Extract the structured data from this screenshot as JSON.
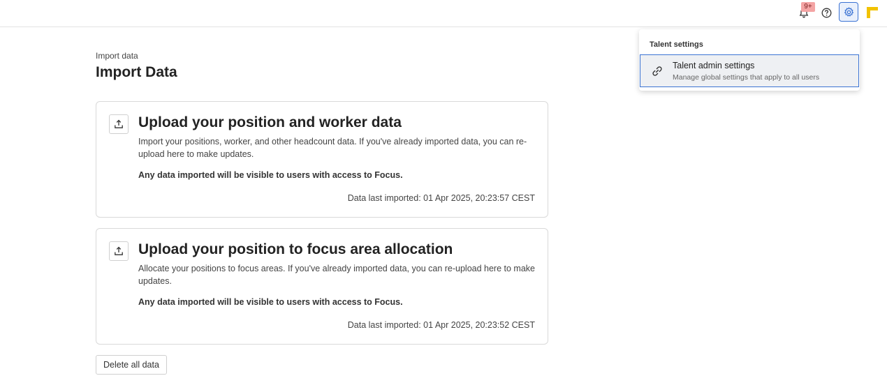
{
  "topbar": {
    "notifications_badge": "9+",
    "icons": [
      "bell-icon",
      "help-icon",
      "gear-icon",
      "app-logo"
    ],
    "accent_color": "#3b73d3",
    "logo_color": "#f2c200"
  },
  "breadcrumb": "Import data",
  "page_title": "Import Data",
  "cards": [
    {
      "title": "Upload your position and worker data",
      "description": "Import your positions, worker, and other headcount data. If you've already imported data, you can re-upload here to make updates.",
      "warning": "Any data imported will be visible to users with access to Focus.",
      "last_imported": "Data last imported: 01 Apr 2025, 20:23:57 CEST"
    },
    {
      "title": "Upload your position to focus area allocation",
      "description": "Allocate your positions to focus areas. If you've already imported data, you can re-upload here to make updates.",
      "warning": "Any data imported will be visible to users with access to Focus.",
      "last_imported": "Data last imported: 01 Apr 2025, 20:23:52 CEST"
    }
  ],
  "delete_label": "Delete all data",
  "settings_menu": {
    "heading": "Talent settings",
    "items": [
      {
        "label": "Talent admin settings",
        "description": "Manage global settings that apply to all users",
        "icon": "link-icon"
      }
    ]
  }
}
